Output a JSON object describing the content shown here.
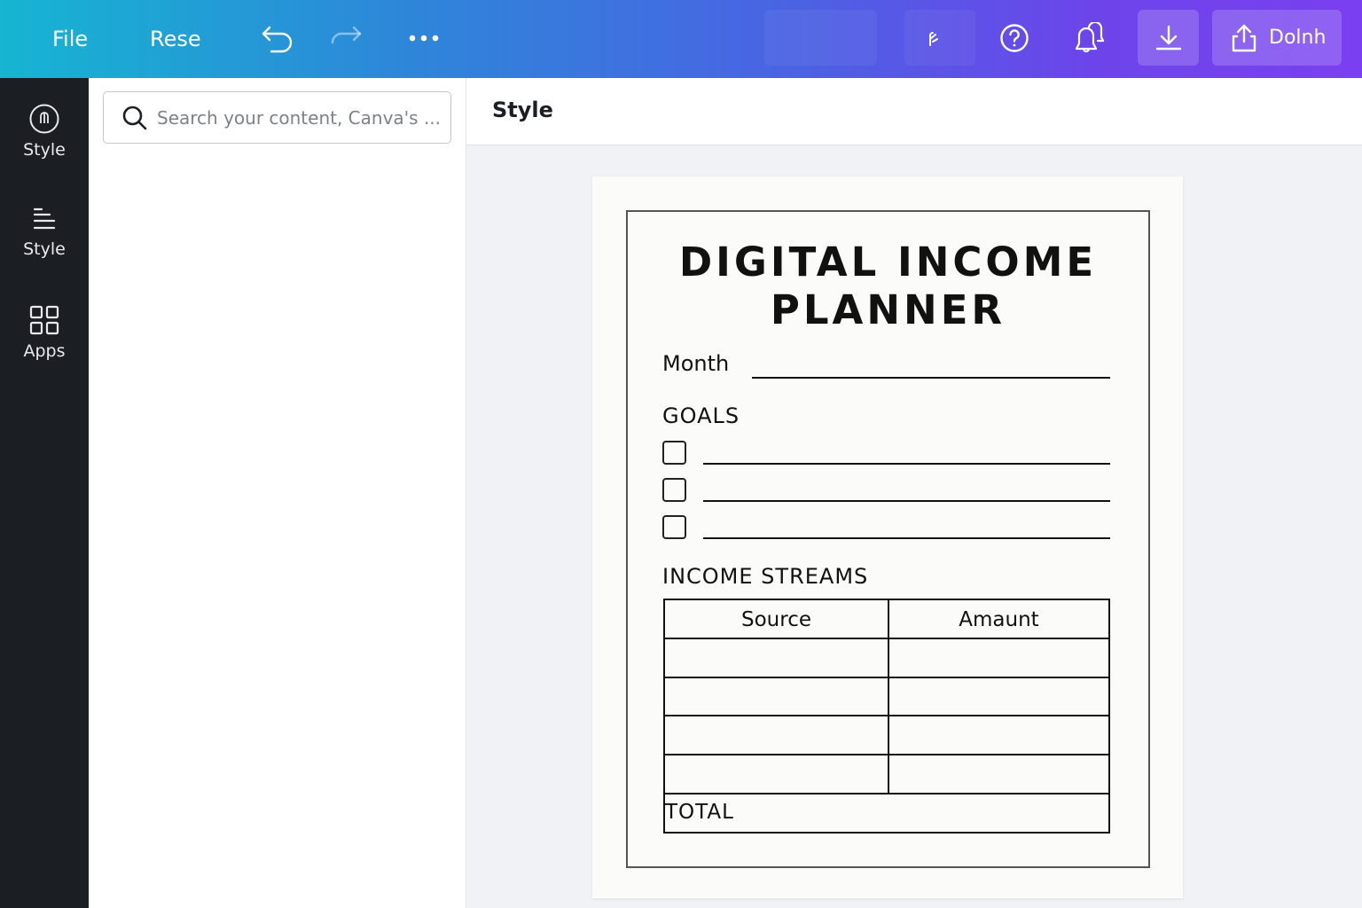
{
  "topbar": {
    "file_label": "File",
    "resize_label": "Rese",
    "undo_icon": "undo-icon",
    "redo_icon": "redo-icon",
    "more_icon": "more-icon",
    "help_icon": "help-icon",
    "comments_icon": "comments-icon",
    "download_icon": "download-icon",
    "share_label": "Dolnh",
    "share_icon": "share-icon"
  },
  "search": {
    "placeholder": "Search your content, Canva's ..."
  },
  "rail": {
    "items": [
      {
        "label": "Style",
        "icon": "style-circle-icon"
      },
      {
        "label": "Style",
        "icon": "text-lines-icon"
      },
      {
        "label": "Apps",
        "icon": "apps-grid-icon"
      }
    ]
  },
  "workspace": {
    "header_title": "Style"
  },
  "document": {
    "title": "DIGITAL INCOME PLANNER",
    "month_label": "Month",
    "goals_label": "GOALS",
    "goals_count": 3,
    "streams_label": "INCOME STREAMS",
    "table": {
      "headers": [
        "Source",
        "Amaunt"
      ],
      "rows": [
        [
          "",
          ""
        ],
        [
          "",
          ""
        ],
        [
          "",
          ""
        ],
        [
          "",
          ""
        ]
      ],
      "total_label": "TOTAL"
    }
  },
  "colors": {
    "rail_bg": "#1b1f24",
    "workspace_bg": "#f1f2f5",
    "topbar_start": "#16b5d2",
    "topbar_end": "#7a3ff0"
  }
}
